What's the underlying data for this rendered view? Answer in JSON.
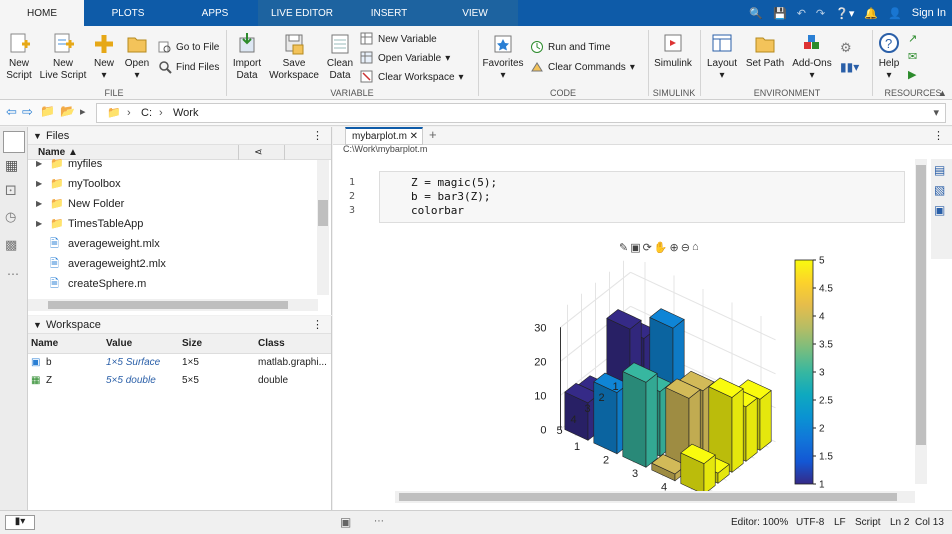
{
  "tabs": [
    "HOME",
    "PLOTS",
    "APPS",
    "LIVE EDITOR",
    "INSERT",
    "VIEW"
  ],
  "signin": "Sign In",
  "ribbon": {
    "new_script": "New\nScript",
    "new_live_script": "New\nLive Script",
    "new": "New",
    "open": "Open",
    "go_to_file": "Go to File",
    "find_files": "Find Files",
    "file_group": "FILE",
    "import_data": "Import\nData",
    "save_workspace": "Save\nWorkspace",
    "clean_data": "Clean\nData",
    "new_variable": "New Variable",
    "open_variable": "Open Variable",
    "clear_workspace": "Clear Workspace",
    "variable_group": "VARIABLE",
    "favorites": "Favorites",
    "run_and_time": "Run and Time",
    "clear_commands": "Clear Commands",
    "code_group": "CODE",
    "simulink": "Simulink",
    "simulink_group": "SIMULINK",
    "layout": "Layout",
    "set_path": "Set Path",
    "add_ons": "Add-Ons",
    "environment_group": "ENVIRONMENT",
    "help": "Help",
    "resources_group": "RESOURCES"
  },
  "address": {
    "drive": "C:",
    "folder": "Work"
  },
  "files": {
    "title": "Files",
    "col_name": "Name",
    "items": [
      {
        "name": "myfiles",
        "type": "folder"
      },
      {
        "name": "myToolbox",
        "type": "folder"
      },
      {
        "name": "New Folder",
        "type": "folder"
      },
      {
        "name": "TimesTableApp",
        "type": "folder"
      },
      {
        "name": "averageweight.mlx",
        "type": "mlx"
      },
      {
        "name": "averageweight2.mlx",
        "type": "mlx"
      },
      {
        "name": "createSphere.m",
        "type": "m"
      }
    ]
  },
  "workspace": {
    "title": "Workspace",
    "cols": [
      "Name",
      "Value",
      "Size",
      "Class"
    ],
    "rows": [
      {
        "name": "b",
        "value": "1×5 Surface",
        "size": "1×5",
        "class": "matlab.graphi..."
      },
      {
        "name": "Z",
        "value": "5×5 double",
        "size": "5×5",
        "class": "double"
      }
    ]
  },
  "editor": {
    "tab": "mybarplot.m",
    "path": "C:\\Work\\mybarplot.m",
    "lines": [
      {
        "num": "1",
        "code": "Z = magic(5);"
      },
      {
        "num": "2",
        "code": "b = bar3(Z);"
      },
      {
        "num": "3",
        "code": "colorbar"
      }
    ]
  },
  "chart_data": {
    "type": "bar",
    "z_ticks": [
      "30",
      "20",
      "10",
      "0"
    ],
    "x_ticks": [
      "1",
      "2",
      "3",
      "4",
      "5"
    ],
    "y_ticks": [
      "1",
      "2",
      "3",
      "4",
      "5"
    ],
    "colorbar_ticks": [
      "5",
      "4.5",
      "4",
      "3.5",
      "3",
      "2.5",
      "2",
      "1.5",
      "1"
    ],
    "matrix": [
      [
        17,
        24,
        1,
        8,
        15
      ],
      [
        23,
        5,
        7,
        14,
        16
      ],
      [
        4,
        6,
        13,
        20,
        22
      ],
      [
        10,
        12,
        19,
        21,
        3
      ],
      [
        11,
        18,
        25,
        2,
        9
      ]
    ],
    "colormap": "parula"
  },
  "status": {
    "zoom": "Editor: 100%",
    "encoding": "UTF-8",
    "eol": "LF",
    "type": "Script",
    "pos": "Ln 2  Col 13"
  },
  "colors": {
    "accent": "#0e5ba8",
    "yellow": "#f8fa0d",
    "blue": "#352a87"
  }
}
